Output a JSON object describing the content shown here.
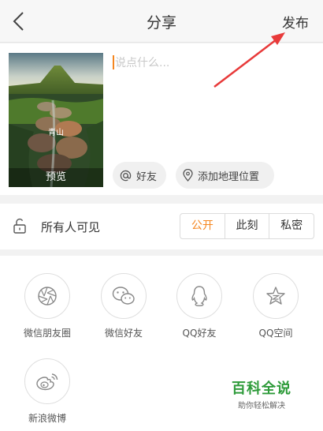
{
  "header": {
    "title": "分享",
    "publish_label": "发布"
  },
  "compose": {
    "placeholder": "说点什么...",
    "image_tag": "青山",
    "preview_label": "预览",
    "friends_label": "好友",
    "location_label": "添加地理位置"
  },
  "visibility": {
    "label": "所有人可见",
    "options": [
      "公开",
      "此刻",
      "私密"
    ],
    "selected": "公开"
  },
  "share": {
    "targets": [
      {
        "label": "微信朋友圈",
        "icon": "aperture-icon"
      },
      {
        "label": "微信好友",
        "icon": "wechat-icon"
      },
      {
        "label": "QQ好友",
        "icon": "qq-penguin-icon"
      },
      {
        "label": "QQ空间",
        "icon": "qzone-star-icon"
      },
      {
        "label": "新浪微博",
        "icon": "weibo-icon"
      }
    ]
  },
  "watermark": {
    "title": "百科全说",
    "subtitle": "助你轻松解决"
  },
  "colors": {
    "accent": "#f5861f",
    "annotation": "#e83a3a",
    "watermark": "#2e9b3a"
  }
}
